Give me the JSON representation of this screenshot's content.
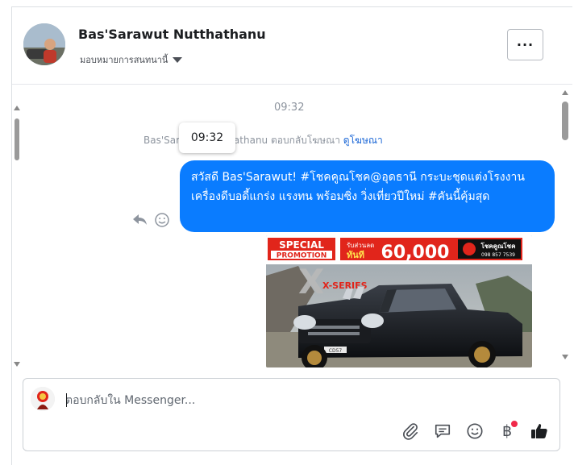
{
  "header": {
    "contact_name": "Bas'Sarawut Nutthathanu",
    "assign_label": "มอบหมายการสนทนานี้",
    "more_label": "···"
  },
  "conversation": {
    "timestamp": "09:32",
    "tooltip_time": "09:32",
    "reply_note_prefix": "Bas'Sarawut Nutthathanu ตอบกลับโฆษณา",
    "reply_note_link": "ดูโฆษณา",
    "message_text": "สวัสดี Bas'Sarawut! #โชคคูณโชค@อุดธานี กระบะชุดแต่งโรงงาน เครื่องดีบอดี้แกร่ง แรงทน พร้อมซิ่ง วิ่งเที่ยวปีใหม่ #คันนี้คุ้มสุด"
  },
  "ad": {
    "badge_line1": "SPECIAL",
    "badge_line2": "PROMOTION",
    "discount_label_1": "รับส่วนลด",
    "discount_label_2": "ทันที",
    "amount": "60,000",
    "dealer": "โชคคูณโชค",
    "phone": "098 857 7539",
    "series": "X-SERIES",
    "plate": "CD57"
  },
  "composer": {
    "placeholder": "ตอบกลับใน Messenger...",
    "tools": [
      "paperclip-icon",
      "chat-bubble-icon",
      "emoji-icon",
      "baht-icon",
      "thumbs-up-icon"
    ],
    "baht_symbol": "฿"
  },
  "colors": {
    "bubble": "#0a7cff",
    "link": "#1a66d6",
    "promo_red": "#e1251b",
    "notification_dot": "#f02849"
  }
}
